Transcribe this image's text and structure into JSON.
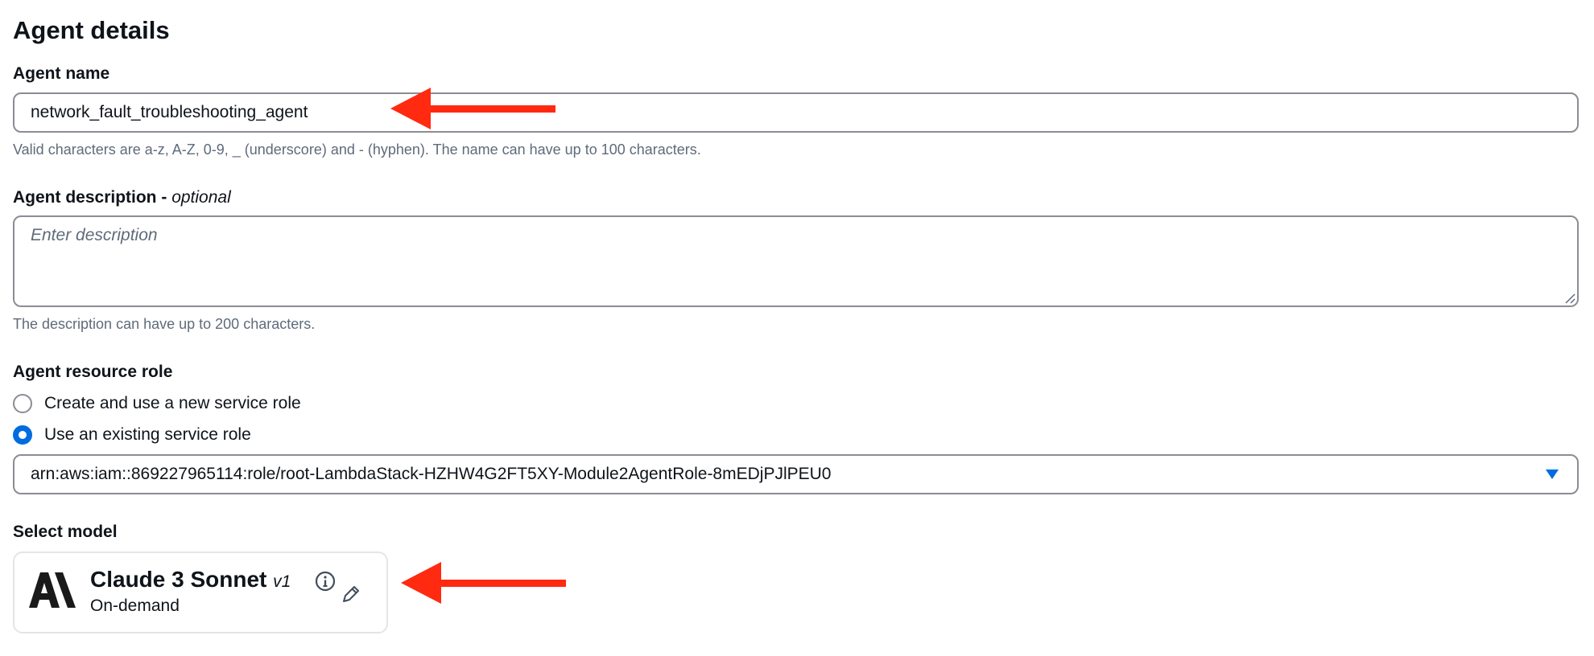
{
  "section": {
    "title": "Agent details"
  },
  "agent_name": {
    "label": "Agent name",
    "value": "network_fault_troubleshooting_agent",
    "hint": "Valid characters are a-z, A-Z, 0-9, _ (underscore) and - (hyphen). The name can have up to 100 characters."
  },
  "agent_description": {
    "label": "Agent description",
    "label_suffix": "optional",
    "placeholder": "Enter description",
    "hint": "The description can have up to 200 characters."
  },
  "resource_role": {
    "label": "Agent resource role",
    "options": [
      {
        "label": "Create and use a new service role",
        "checked": false
      },
      {
        "label": "Use an existing service role",
        "checked": true
      }
    ],
    "selected_role": "arn:aws:iam::869227965114:role/root-LambdaStack-HZHW4G2FT5XY-Module2AgentRole-8mEDjPJlPEU0"
  },
  "model": {
    "label": "Select model",
    "provider_logo_text": "A\\",
    "name": "Claude 3 Sonnet",
    "version": "v1",
    "mode": "On-demand",
    "icons": {
      "info": "info-icon",
      "edit": "pencil-icon"
    }
  },
  "colors": {
    "accent": "#006ce0",
    "arrow": "#ff2a10",
    "border": "#8c8c94"
  }
}
